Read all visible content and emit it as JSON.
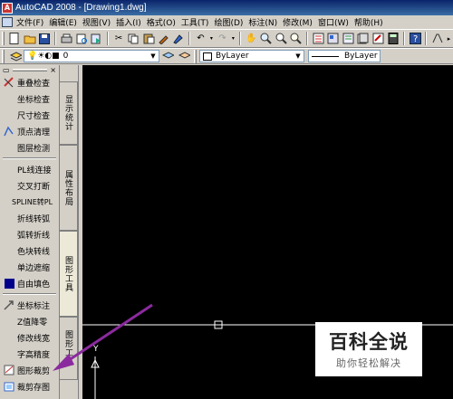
{
  "window": {
    "title": "AutoCAD 2008 - [Drawing1.dwg]"
  },
  "menu": [
    "文件(F)",
    "编辑(E)",
    "视图(V)",
    "插入(I)",
    "格式(O)",
    "工具(T)",
    "绘图(D)",
    "标注(N)",
    "修改(M)",
    "窗口(W)",
    "帮助(H)"
  ],
  "layer_toolbar": {
    "layer_value": "0",
    "color_value": "ByLayer",
    "linetype_value": "ByLayer"
  },
  "panel": {
    "items_group1": [
      "重叠检查",
      "坐标检查",
      "尺寸检查",
      "顶点清理",
      "图层检测"
    ],
    "items_group2": [
      "PL线连接",
      "交叉打断",
      "SPLINE转PL",
      "折线转弧",
      "弧转折线",
      "色块转线",
      "单边遮缩",
      "自由填色"
    ],
    "items_group3": [
      "坐标标注",
      "Z值降零",
      "修改线宽",
      "字高精度",
      "图形裁剪",
      "裁剪存图"
    ]
  },
  "side_tabs": [
    "显示统计",
    "属性布局",
    "图形工具",
    "图形工具"
  ],
  "canvas": {
    "ucs_label": "Y",
    "background": "#000000"
  },
  "watermark": {
    "main": "百科全说",
    "sub": "助你轻松解决"
  },
  "colors": {
    "titlebar": "#0a246a",
    "arrow": "#8b2a9e",
    "fill_swatch": "#00008b"
  }
}
